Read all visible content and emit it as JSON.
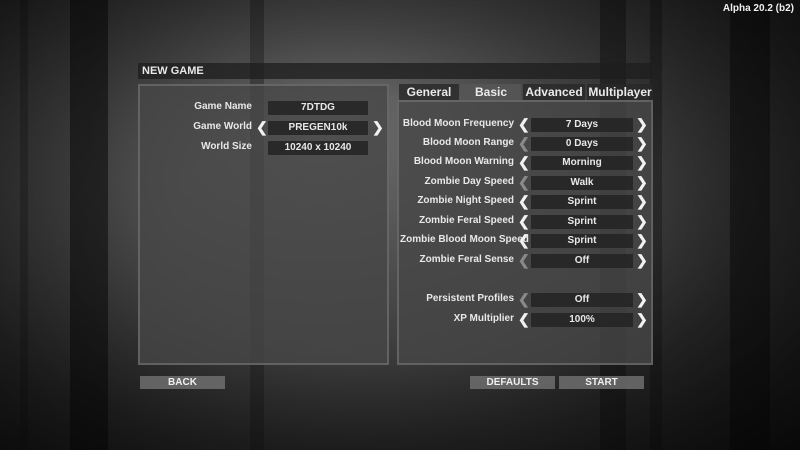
{
  "version": "Alpha 20.2 (b2)",
  "title": "NEW GAME",
  "left": {
    "game_name_label": "Game Name",
    "game_name_value": "7DTDG",
    "game_world_label": "Game World",
    "game_world_value": "PREGEN10k",
    "world_size_label": "World Size",
    "world_size_value": "10240 x 10240"
  },
  "tabs": [
    "General",
    "Basic",
    "Advanced",
    "Multiplayer"
  ],
  "active_tab": "Basic",
  "settings": [
    {
      "label": "Blood Moon Frequency",
      "value": "7 Days"
    },
    {
      "label": "Blood Moon Range",
      "value": "0 Days"
    },
    {
      "label": "Blood Moon Warning",
      "value": "Morning"
    },
    {
      "label": "Zombie Day Speed",
      "value": "Walk"
    },
    {
      "label": "Zombie Night Speed",
      "value": "Sprint"
    },
    {
      "label": "Zombie Feral Speed",
      "value": "Sprint"
    },
    {
      "label": "Zombie Blood Moon Speed",
      "value": "Sprint"
    },
    {
      "label": "Zombie Feral Sense",
      "value": "Off"
    },
    {
      "label": "Persistent Profiles",
      "value": "Off"
    },
    {
      "label": "XP Multiplier",
      "value": "100%"
    }
  ],
  "buttons": {
    "back": "BACK",
    "defaults": "DEFAULTS",
    "start": "START"
  },
  "icons": {
    "left_arrow": "chevron-left-icon",
    "right_arrow": "chevron-right-icon"
  }
}
